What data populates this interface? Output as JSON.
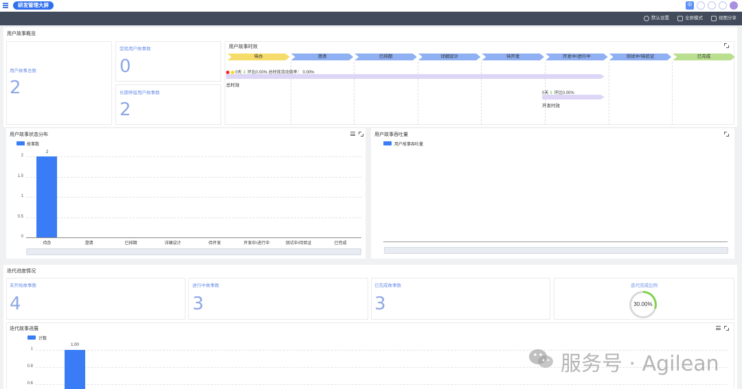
{
  "app": {
    "title": "研发管理大屏"
  },
  "topbar": {
    "lang": "中",
    "icons": [
      "headset-icon",
      "user-circle-icon",
      "chat-icon",
      "avatar"
    ]
  },
  "toolbar": {
    "settings": "默认设置",
    "fullscreen": "全屏模式",
    "share": "视图分享"
  },
  "overview": {
    "title": "用户故事概览",
    "total_label": "用户故事总数",
    "total_value": "2",
    "blocked_label": "受阻用户故事数",
    "blocked_value": "0",
    "stale_label": "长期停留用户故事数",
    "stale_value": "2"
  },
  "timeline": {
    "title": "用户故事时效",
    "phases": [
      "待办",
      "澄清",
      "已排期",
      "详细设计",
      "待开发",
      "开发中/进行中",
      "测试中/待验证",
      "已完成"
    ],
    "phase_colors": [
      "#f6dd6b",
      "#8fb0f3",
      "#8fb0f3",
      "#8fb0f3",
      "#8fb0f3",
      "#8fb0f3",
      "#8fb0f3",
      "#b9df8f"
    ],
    "total_stats": {
      "days": "0天",
      "ratio_label": "环比0.00%",
      "eff_label": "总时效流动效率：",
      "eff_value": "0.00%"
    },
    "total_label": "总时效",
    "dev_stats": {
      "days": "0天",
      "ratio_label": "环比0.00%"
    },
    "dev_label": "开发时效"
  },
  "status_chart": {
    "title": "用户故事状态分布",
    "legend": "故事数",
    "y_ticks": [
      "2",
      "1.5",
      "1",
      "0.5",
      "0"
    ],
    "top_label": "2"
  },
  "throughput_chart": {
    "title": "用户故事吞吐量",
    "legend": "用户故事吞吐量"
  },
  "iteration": {
    "title": "迭代进度情况",
    "not_started_label": "未开始故事数",
    "not_started_value": "4",
    "in_progress_label": "进行中故事数",
    "in_progress_value": "3",
    "done_label": "已完成故事数",
    "done_value": "3",
    "ratio_label": "迭代完成比例",
    "ratio_value": "30.00%",
    "ratio_fraction": 0.3
  },
  "progress_chart": {
    "title": "迭代故事进展",
    "legend": "计数",
    "y_ticks": [
      "1",
      "0.8",
      "0.6"
    ],
    "top_label": "1.00"
  },
  "watermark": "服务号 · Agilean",
  "chart_data": [
    {
      "type": "bar",
      "title": "用户故事状态分布",
      "categories": [
        "待办",
        "澄清",
        "已排期",
        "详细设计",
        "待开发",
        "开发中/进行中",
        "测试中/待验证",
        "已完成"
      ],
      "series": [
        {
          "name": "故事数",
          "values": [
            2,
            0,
            0,
            0,
            0,
            0,
            0,
            0
          ]
        }
      ],
      "ylim": [
        0,
        2
      ],
      "grid": true,
      "legend": "top-left"
    },
    {
      "type": "bar",
      "title": "迭代故事进展",
      "series": [
        {
          "name": "计数",
          "values": [
            1
          ]
        }
      ],
      "ylim": [
        0.6,
        1
      ],
      "grid": true,
      "legend": "top-left"
    }
  ]
}
